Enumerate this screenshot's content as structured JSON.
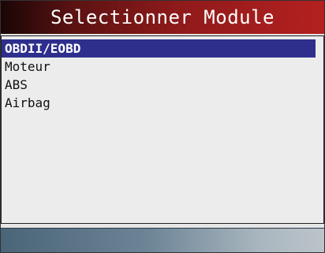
{
  "header": {
    "title": "Selectionner Module"
  },
  "menu": {
    "items": [
      {
        "label": "OBDII/EOBD",
        "selected": true
      },
      {
        "label": "Moteur",
        "selected": false
      },
      {
        "label": "ABS",
        "selected": false
      },
      {
        "label": "Airbag",
        "selected": false
      }
    ]
  },
  "colors": {
    "title_bar": "#8f1a1a",
    "selection": "#2e2f8c",
    "bottom_bar": "#6c8496"
  }
}
